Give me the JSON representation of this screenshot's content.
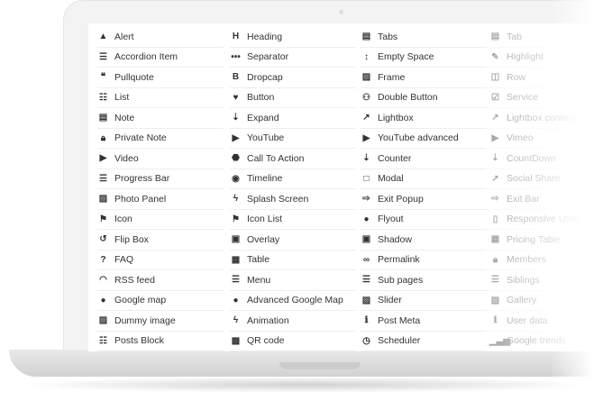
{
  "columns": [
    [
      {
        "label": "Alert",
        "icon": "▲"
      },
      {
        "label": "Accordion Item",
        "icon": "☰"
      },
      {
        "label": "Pullquote",
        "icon": "❝"
      },
      {
        "label": "List",
        "icon": "☷"
      },
      {
        "label": "Note",
        "icon": "▤"
      },
      {
        "label": "Private Note",
        "icon": "🔒︎"
      },
      {
        "label": "Video",
        "icon": "▶"
      },
      {
        "label": "Progress Bar",
        "icon": "☰"
      },
      {
        "label": "Photo Panel",
        "icon": "▨"
      },
      {
        "label": "Icon",
        "icon": "⚑"
      },
      {
        "label": "Flip Box",
        "icon": "↺"
      },
      {
        "label": "FAQ",
        "icon": "?"
      },
      {
        "label": "RSS feed",
        "icon": "◠"
      },
      {
        "label": "Google map",
        "icon": "●"
      },
      {
        "label": "Dummy image",
        "icon": "▨"
      },
      {
        "label": "Posts Block",
        "icon": "☷"
      }
    ],
    [
      {
        "label": "Heading",
        "icon": "H"
      },
      {
        "label": "Separator",
        "icon": "•••"
      },
      {
        "label": "Dropcap",
        "icon": "B"
      },
      {
        "label": "Button",
        "icon": "♥"
      },
      {
        "label": "Expand",
        "icon": "⇣"
      },
      {
        "label": "YouTube",
        "icon": "▶"
      },
      {
        "label": "Call To Action",
        "icon": "⬣"
      },
      {
        "label": "Timeline",
        "icon": "◉"
      },
      {
        "label": "Splash Screen",
        "icon": "ϟ"
      },
      {
        "label": "Icon List",
        "icon": "⚑"
      },
      {
        "label": "Overlay",
        "icon": "▣"
      },
      {
        "label": "Table",
        "icon": "▦"
      },
      {
        "label": "Menu",
        "icon": "☰"
      },
      {
        "label": "Advanced Google Map",
        "icon": "●"
      },
      {
        "label": "Animation",
        "icon": "ϟ"
      },
      {
        "label": "QR code",
        "icon": "▩"
      }
    ],
    [
      {
        "label": "Tabs",
        "icon": "▤"
      },
      {
        "label": "Empty Space",
        "icon": "↕"
      },
      {
        "label": "Frame",
        "icon": "▨"
      },
      {
        "label": "Double Button",
        "icon": "⚇"
      },
      {
        "label": "Lightbox",
        "icon": "↗"
      },
      {
        "label": "YouTube advanced",
        "icon": "▶"
      },
      {
        "label": "Counter",
        "icon": "⇣"
      },
      {
        "label": "Modal",
        "icon": "□"
      },
      {
        "label": "Exit Popup",
        "icon": "⇨"
      },
      {
        "label": "Flyout",
        "icon": "●"
      },
      {
        "label": "Shadow",
        "icon": "▣"
      },
      {
        "label": "Permalink",
        "icon": "∞"
      },
      {
        "label": "Sub pages",
        "icon": "☰"
      },
      {
        "label": "Slider",
        "icon": "▨"
      },
      {
        "label": "Post Meta",
        "icon": "ℹ"
      },
      {
        "label": "Scheduler",
        "icon": "◷"
      }
    ],
    [
      {
        "label": "Tab",
        "icon": "▤"
      },
      {
        "label": "Highlight",
        "icon": "✎"
      },
      {
        "label": "Row",
        "icon": "◫"
      },
      {
        "label": "Service",
        "icon": "☑"
      },
      {
        "label": "Lightbox content",
        "icon": "↗"
      },
      {
        "label": "Vimeo",
        "icon": "▶"
      },
      {
        "label": "CountDown",
        "icon": "⇣"
      },
      {
        "label": "Social Share",
        "icon": "↗"
      },
      {
        "label": "Exit Bar",
        "icon": "⇨"
      },
      {
        "label": "Responsive Utility",
        "icon": "▯"
      },
      {
        "label": "Pricing Table",
        "icon": "▦"
      },
      {
        "label": "Members",
        "icon": "🔒︎"
      },
      {
        "label": "Siblings",
        "icon": "☰"
      },
      {
        "label": "Gallery",
        "icon": "▨"
      },
      {
        "label": "User data",
        "icon": "ℹ"
      },
      {
        "label": "Google trends",
        "icon": "▁▃▅"
      }
    ]
  ]
}
